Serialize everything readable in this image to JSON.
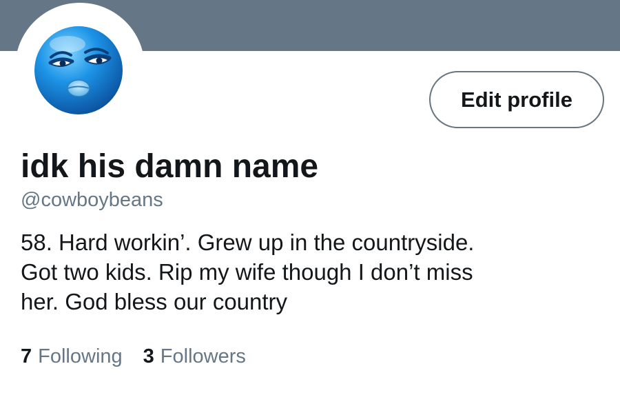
{
  "profile": {
    "display_name": "idk his damn name",
    "handle": "@cowboybeans",
    "bio_lines": [
      "58. Hard workin’. Grew up in the countryside.",
      "Got two kids. Rip my wife though I don’t miss",
      "her. God bless our country"
    ],
    "avatar_icon": "blue-smirk-emoji-icon"
  },
  "actions": {
    "edit_profile_label": "Edit profile"
  },
  "stats": {
    "following_count": "7",
    "following_label": "Following",
    "followers_count": "3",
    "followers_label": "Followers"
  },
  "colors": {
    "banner": "#657786",
    "text_primary": "#14171a",
    "text_secondary": "#657786",
    "avatar_blue": "#1a8fe0"
  }
}
